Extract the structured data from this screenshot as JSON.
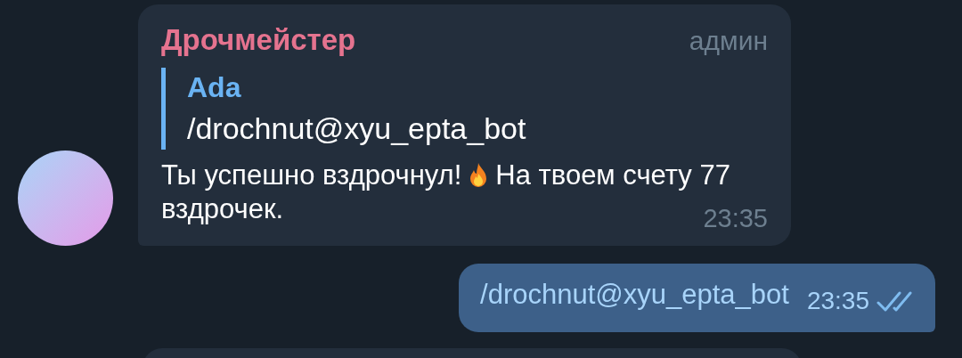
{
  "messages": [
    {
      "kind": "incoming",
      "sender": {
        "name": "Дрочмейстер",
        "color": "#e5738f"
      },
      "badge": "админ",
      "reply": {
        "author": "Ada",
        "text": "/drochnut@xyu_epta_bot"
      },
      "text_before_icon": "Ты успешно вздрочнул!",
      "text_after_icon": [
        "На твоем счету 77",
        "вздрочек."
      ],
      "time": "23:35"
    },
    {
      "kind": "outgoing",
      "text": "/drochnut@xyu_epta_bot",
      "time": "23:35",
      "read": true
    }
  ]
}
